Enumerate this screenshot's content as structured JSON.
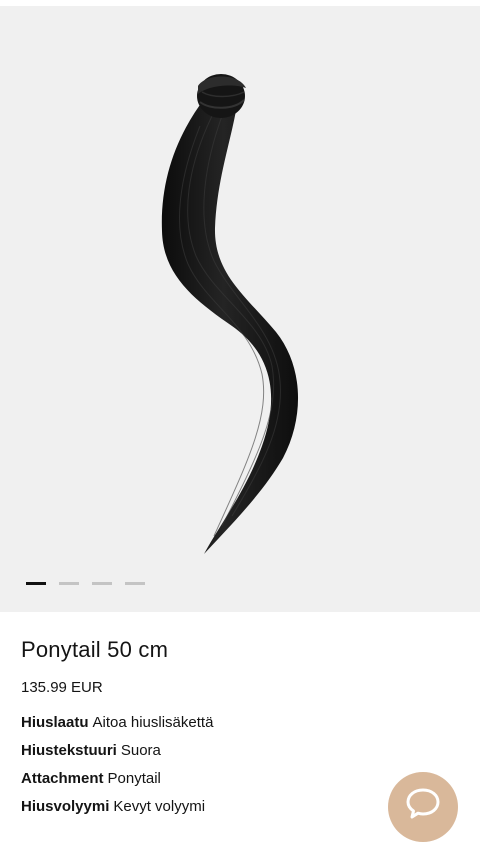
{
  "gallery": {
    "image_alt": "Ponytail hair extension",
    "slide_count": 4,
    "active_slide": 1
  },
  "product": {
    "title": "Ponytail 50 cm",
    "price": "135.99 EUR",
    "attributes": [
      {
        "label": "Hiuslaatu",
        "value": "Aitoa hiuslisäkettä"
      },
      {
        "label": "Hiustekstuuri",
        "value": "Suora"
      },
      {
        "label": "Attachment",
        "value": "Ponytail"
      },
      {
        "label": "Hiusvolyymi",
        "value": "Kevyt volyymi"
      }
    ]
  },
  "chat": {
    "icon": "chat-bubble-icon",
    "color": "#d9b89a"
  },
  "colors": {
    "gallery_bg": "#f0f0f0",
    "hair": "#141414",
    "dot_active": "#111111",
    "dot_inactive": "#c4c4c4"
  }
}
